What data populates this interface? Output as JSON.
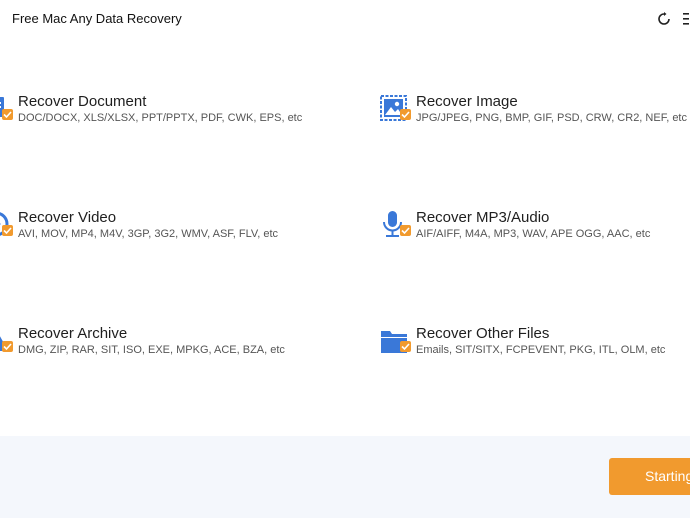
{
  "app": {
    "title": "Free Mac Any Data Recovery"
  },
  "categories": [
    {
      "title": "Recover Document",
      "extensions": "DOC/DOCX, XLS/XLSX, PPT/PPTX, PDF, CWK, EPS, etc",
      "icon": "document-icon",
      "checked": true
    },
    {
      "title": "Recover Image",
      "extensions": "JPG/JPEG, PNG, BMP, GIF, PSD, CRW, CR2, NEF, etc",
      "icon": "image-icon",
      "checked": true
    },
    {
      "title": "Recover Video",
      "extensions": "AVI, MOV, MP4, M4V, 3GP, 3G2, WMV, ASF, FLV, etc",
      "icon": "video-icon",
      "checked": true
    },
    {
      "title": "Recover MP3/Audio",
      "extensions": "AIF/AIFF, M4A, MP3, WAV, APE OGG, AAC, etc",
      "icon": "microphone-icon",
      "checked": true
    },
    {
      "title": "Recover Archive",
      "extensions": "DMG, ZIP, RAR, SIT, ISO, EXE, MPKG, ACE, BZA, etc",
      "icon": "archive-icon",
      "checked": true
    },
    {
      "title": "Recover Other Files",
      "extensions": "Emails, SIT/SITX, FCPEVENT, PKG, ITL, OLM, etc",
      "icon": "folder-icon",
      "checked": true
    }
  ],
  "footer": {
    "start_label": "Starting"
  },
  "colors": {
    "accent": "#f19a2e",
    "icon_blue": "#3a78d8",
    "footer_bg": "#f4f7fc"
  }
}
